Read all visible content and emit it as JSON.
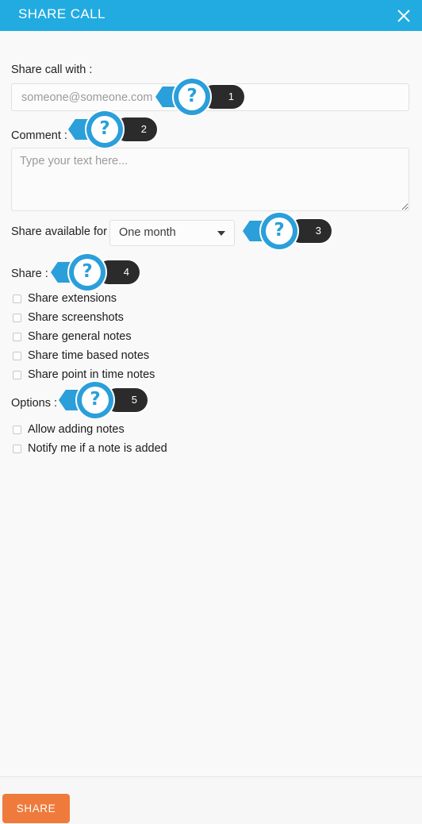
{
  "header": {
    "title": "SHARE CALL",
    "close_icon": "close-icon"
  },
  "colors": {
    "header_blue": "#21abe0",
    "callout_blue": "#2a9fda",
    "callout_pill": "#2b2b2b",
    "share_orange": "#ee7b3c",
    "panel_bg": "#f9f9f9"
  },
  "form": {
    "share_with": {
      "label": "Share call with :",
      "value": "",
      "placeholder": "someone@someone.com"
    },
    "comment": {
      "label": "Comment :",
      "value": "",
      "placeholder": "Type your text here..."
    },
    "available_for": {
      "label": "Share available for :",
      "selected": "One month",
      "caret_icon": "chevron-down-icon"
    },
    "share_section": {
      "label": "Share :",
      "items": [
        {
          "label": "Share extensions",
          "checked": false
        },
        {
          "label": "Share screenshots",
          "checked": false
        },
        {
          "label": "Share general notes",
          "checked": false
        },
        {
          "label": "Share time based notes",
          "checked": false
        },
        {
          "label": "Share point in time notes",
          "checked": false
        }
      ]
    },
    "options_section": {
      "label": "Options :",
      "items": [
        {
          "label": "Allow adding notes",
          "checked": false
        },
        {
          "label": "Notify me if a note is added",
          "checked": false
        }
      ]
    }
  },
  "footer": {
    "share_button": "SHARE"
  },
  "callouts": [
    {
      "number": "1",
      "symbol": "?"
    },
    {
      "number": "2",
      "symbol": "?"
    },
    {
      "number": "3",
      "symbol": "?"
    },
    {
      "number": "4",
      "symbol": "?"
    },
    {
      "number": "5",
      "symbol": "?"
    }
  ]
}
